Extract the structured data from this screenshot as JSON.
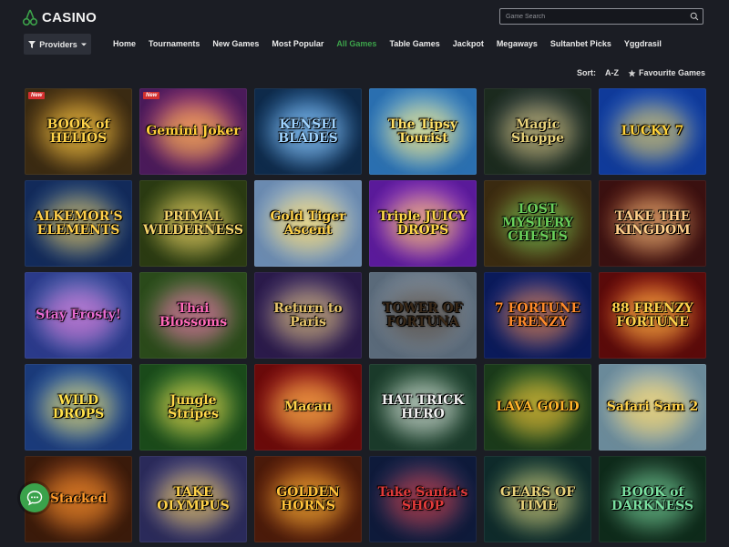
{
  "brand": {
    "name": "CASINO",
    "accent": "#3ca24a"
  },
  "search": {
    "placeholder": "Game Search",
    "icon": "search-icon"
  },
  "providers": {
    "label": "Providers"
  },
  "nav": [
    {
      "label": "Home",
      "active": false
    },
    {
      "label": "Tournaments",
      "active": false
    },
    {
      "label": "New Games",
      "active": false
    },
    {
      "label": "Most Popular",
      "active": false
    },
    {
      "label": "All Games",
      "active": true
    },
    {
      "label": "Table Games",
      "active": false
    },
    {
      "label": "Jackpot",
      "active": false
    },
    {
      "label": "Megaways",
      "active": false
    },
    {
      "label": "Sultanbet Picks",
      "active": false
    },
    {
      "label": "Yggdrasil",
      "active": false
    }
  ],
  "sort": {
    "label": "Sort:",
    "az": "A-Z",
    "favourites": "Favourite Games"
  },
  "games": [
    {
      "title": "BOOK of HELIOS",
      "bg": "#3a2a12",
      "bg2": "#8a5a1a",
      "color": "#ffd34a",
      "new": true
    },
    {
      "title": "Gemini Joker",
      "bg": "#4a1a5a",
      "bg2": "#c23f8a",
      "color": "#ffcf3a",
      "new": true
    },
    {
      "title": "KENSEI BLADES",
      "bg": "#0e2a4a",
      "bg2": "#2d6fb0",
      "color": "#9fd3ff",
      "new": false
    },
    {
      "title": "The Tipsy Tourist",
      "bg": "#2a6fb0",
      "bg2": "#7ec3ea",
      "color": "#ffe066",
      "new": false
    },
    {
      "title": "Magic Shoppe",
      "bg": "#1b2a1e",
      "bg2": "#3b4a5a",
      "color": "#e8d27a",
      "new": false
    },
    {
      "title": "LUCKY 7",
      "bg": "#0f3a9a",
      "bg2": "#2b6ae0",
      "color": "#ffd23a",
      "new": false
    },
    {
      "title": "ALKEMOR'S ELEMENTS",
      "bg": "#122a5a",
      "bg2": "#2b5a9a",
      "color": "#ffcf4a",
      "new": false
    },
    {
      "title": "PRIMAL WILDERNESS",
      "bg": "#2a3a12",
      "bg2": "#6a7a2a",
      "color": "#f4d36a",
      "new": false
    },
    {
      "title": "Gold Tiger Ascent",
      "bg": "#6a8ab0",
      "bg2": "#b8d2ea",
      "color": "#ffd24a",
      "new": false
    },
    {
      "title": "Triple JUICY DROPS",
      "bg": "#5a1a9a",
      "bg2": "#b04ae0",
      "color": "#ffd84a",
      "new": false
    },
    {
      "title": "LOST MYSTERY CHESTS",
      "bg": "#3a2a10",
      "bg2": "#6a4a1a",
      "color": "#6ad05a",
      "new": false
    },
    {
      "title": "TAKE THE KINGDOM",
      "bg": "#3a1010",
      "bg2": "#7a2a1a",
      "color": "#ffcf8a",
      "new": false
    },
    {
      "title": "Stay Frosty!",
      "bg": "#2a3a8a",
      "bg2": "#6a8ad0",
      "color": "#e66ad0",
      "new": false
    },
    {
      "title": "Thai Blossoms",
      "bg": "#2a4a1a",
      "bg2": "#4a7a3a",
      "color": "#ff6ab8",
      "new": false
    },
    {
      "title": "Return to Paris",
      "bg": "#2a1a4a",
      "bg2": "#5a4a8a",
      "color": "#e6c46a",
      "new": false
    },
    {
      "title": "TOWER OF FORTUNA",
      "bg": "#5a6a7a",
      "bg2": "#aab8c8",
      "color": "#3a2a1a",
      "new": false
    },
    {
      "title": "7 FORTUNE FRENZY",
      "bg": "#0a1a5a",
      "bg2": "#2a3aa0",
      "color": "#ff8a2a",
      "new": false
    },
    {
      "title": "88 FRENZY FORTUNE",
      "bg": "#5a0a0a",
      "bg2": "#c02a1a",
      "color": "#ffd24a",
      "new": false
    },
    {
      "title": "WILD DROPS",
      "bg": "#1a3a7a",
      "bg2": "#3a7ad0",
      "color": "#ffe04a",
      "new": false
    },
    {
      "title": "Jungle Stripes",
      "bg": "#1a4a1a",
      "bg2": "#3a8a3a",
      "color": "#ffd84a",
      "new": false
    },
    {
      "title": "Macau",
      "bg": "#6a0a0a",
      "bg2": "#c02a2a",
      "color": "#ffd24a",
      "new": false
    },
    {
      "title": "HAT TRICK HERO",
      "bg": "#1a3a2a",
      "bg2": "#3a6a4a",
      "color": "#f0f0f0",
      "new": false
    },
    {
      "title": "LAVA GOLD",
      "bg": "#1a3a1a",
      "bg2": "#4a8a3a",
      "color": "#ffb42a",
      "new": false
    },
    {
      "title": "Safari Sam 2",
      "bg": "#6a8a9a",
      "bg2": "#b8cad0",
      "color": "#ffd24a",
      "new": false
    },
    {
      "title": "Stacked",
      "bg": "#3a1a0a",
      "bg2": "#8a3a1a",
      "color": "#ff9a2a",
      "new": false
    },
    {
      "title": "TAKE OLYMPUS",
      "bg": "#2a2a5a",
      "bg2": "#5a5aa0",
      "color": "#ffd24a",
      "new": false
    },
    {
      "title": "GOLDEN HORNS",
      "bg": "#4a1a0a",
      "bg2": "#9a3a12",
      "color": "#ffc23a",
      "new": false
    },
    {
      "title": "Take Santa's SHOP",
      "bg": "#0e1a3a",
      "bg2": "#2a3a6a",
      "color": "#e23a3a",
      "new": false
    },
    {
      "title": "GEARS OF TIME",
      "bg": "#0e2a2a",
      "bg2": "#2a5a4a",
      "color": "#e8d27a",
      "new": false
    },
    {
      "title": "BOOK of DARKNESS",
      "bg": "#0e2a1a",
      "bg2": "#2a4a3a",
      "color": "#7ae0a0",
      "new": false
    }
  ],
  "new_badge": "New",
  "chat": {
    "icon": "chat-icon"
  }
}
